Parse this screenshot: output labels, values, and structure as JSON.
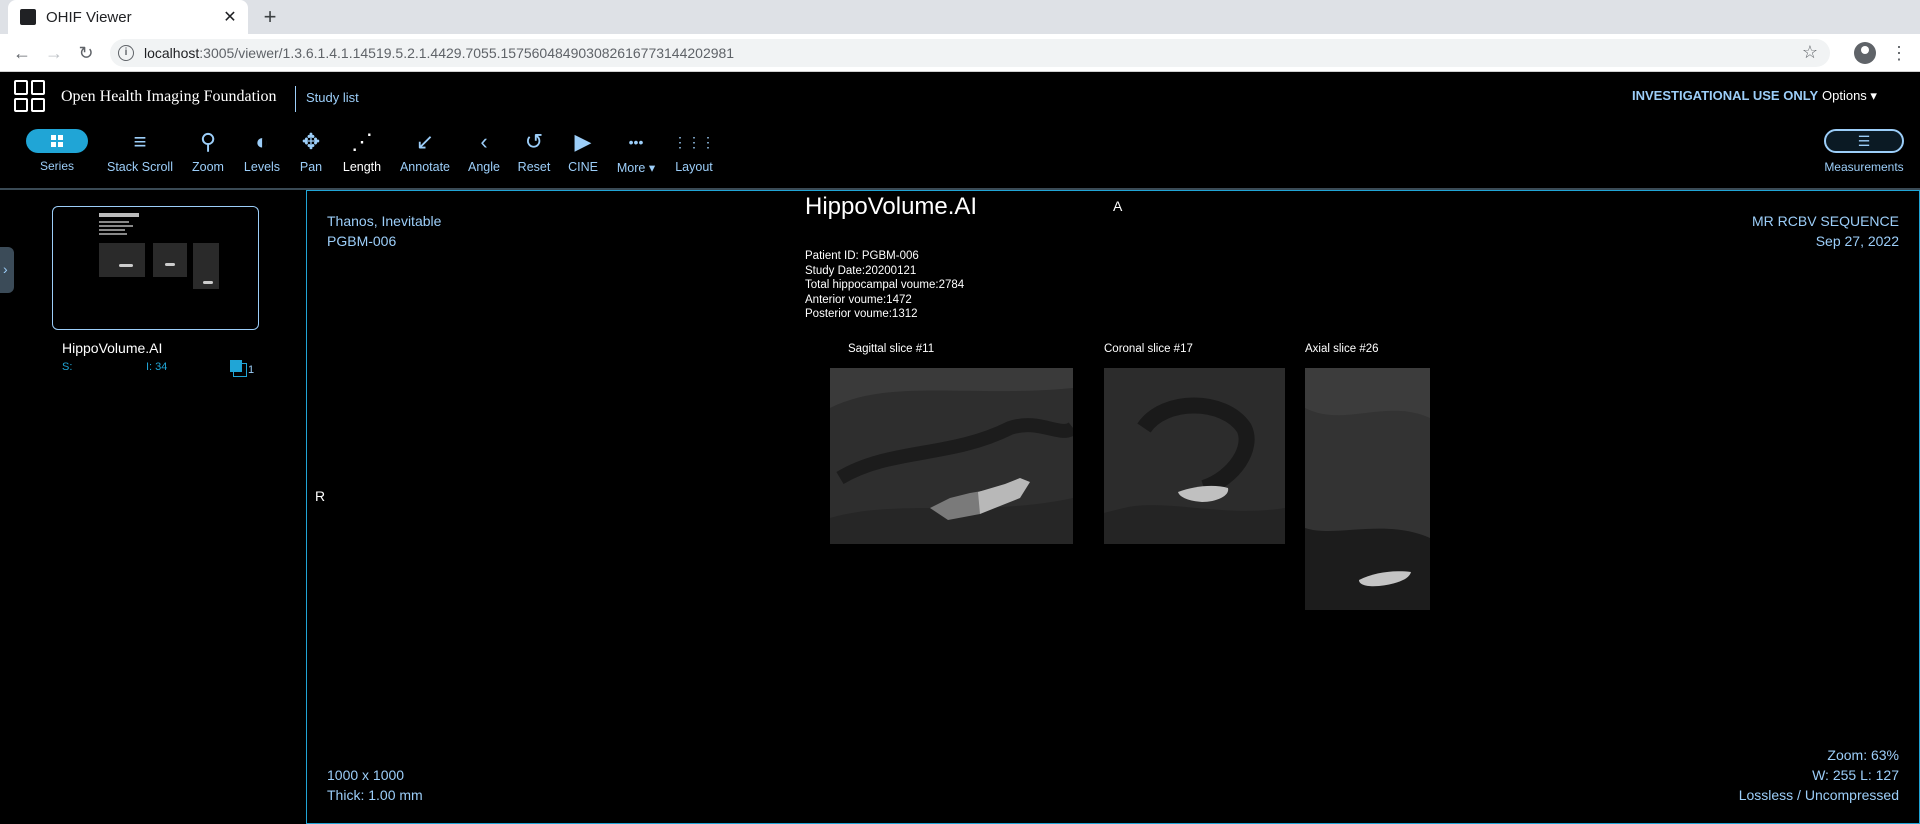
{
  "browser": {
    "tab_title": "OHIF Viewer",
    "tab_close": "✕",
    "new_tab": "+",
    "url_host": "localhost",
    "url_path": ":3005/viewer/1.3.6.1.4.1.14519.5.2.1.4429.7055.157560484903082616773144202981"
  },
  "header": {
    "brand": "Open Health Imaging Foundation",
    "study_list": "Study list",
    "investigational": "INVESTIGATIONAL USE ONLY",
    "options": "Options ▾"
  },
  "toolbar": {
    "series_label": "Series",
    "tools": [
      {
        "label": "Stack Scroll",
        "icon": "≡"
      },
      {
        "label": "Zoom",
        "icon": "⚲"
      },
      {
        "label": "Levels",
        "icon": "◐"
      },
      {
        "label": "Pan",
        "icon": "✥"
      },
      {
        "label": "Length",
        "icon": "⋰"
      },
      {
        "label": "Annotate",
        "icon": "↙"
      },
      {
        "label": "Angle",
        "icon": "‹"
      },
      {
        "label": "Reset",
        "icon": "↺"
      },
      {
        "label": "CINE",
        "icon": "▶"
      },
      {
        "label": "More ▾",
        "icon": "•••"
      },
      {
        "label": "Layout",
        "icon": "⋮⋮⋮"
      }
    ],
    "measurements_label": "Measurements",
    "measurements_icon": "☰"
  },
  "left_panel": {
    "series_name": "HippoVolume.AI",
    "series_s": "S:",
    "series_i": "I: 34",
    "series_count": "1"
  },
  "viewport": {
    "patient_name": "Thanos, Inevitable",
    "patient_id": "PGBM-006",
    "sequence": "MR RCBV SEQUENCE",
    "date": "Sep 27, 2022",
    "dimensions": "1000 x 1000",
    "thickness": "Thick: 1.00 mm",
    "zoom": "Zoom: 63%",
    "window_level": "W: 255 L: 127",
    "compression": "Lossless / Uncompressed",
    "orientation_top": "A",
    "orientation_left": "R",
    "report": {
      "title": "HippoVolume.AI",
      "lines": [
        "Patient ID: PGBM-006",
        "Study Date:20200121",
        "Total hippocampal voume:2784",
        "Anterior voume:1472",
        "Posterior voume:1312"
      ],
      "slices": [
        {
          "label": "Sagittal slice #11"
        },
        {
          "label": "Coronal slice #17"
        },
        {
          "label": "Axial slice #26"
        }
      ]
    }
  },
  "colors": {
    "accent": "#20a5d6",
    "text_light": "#9ccef9",
    "background": "#000000"
  }
}
